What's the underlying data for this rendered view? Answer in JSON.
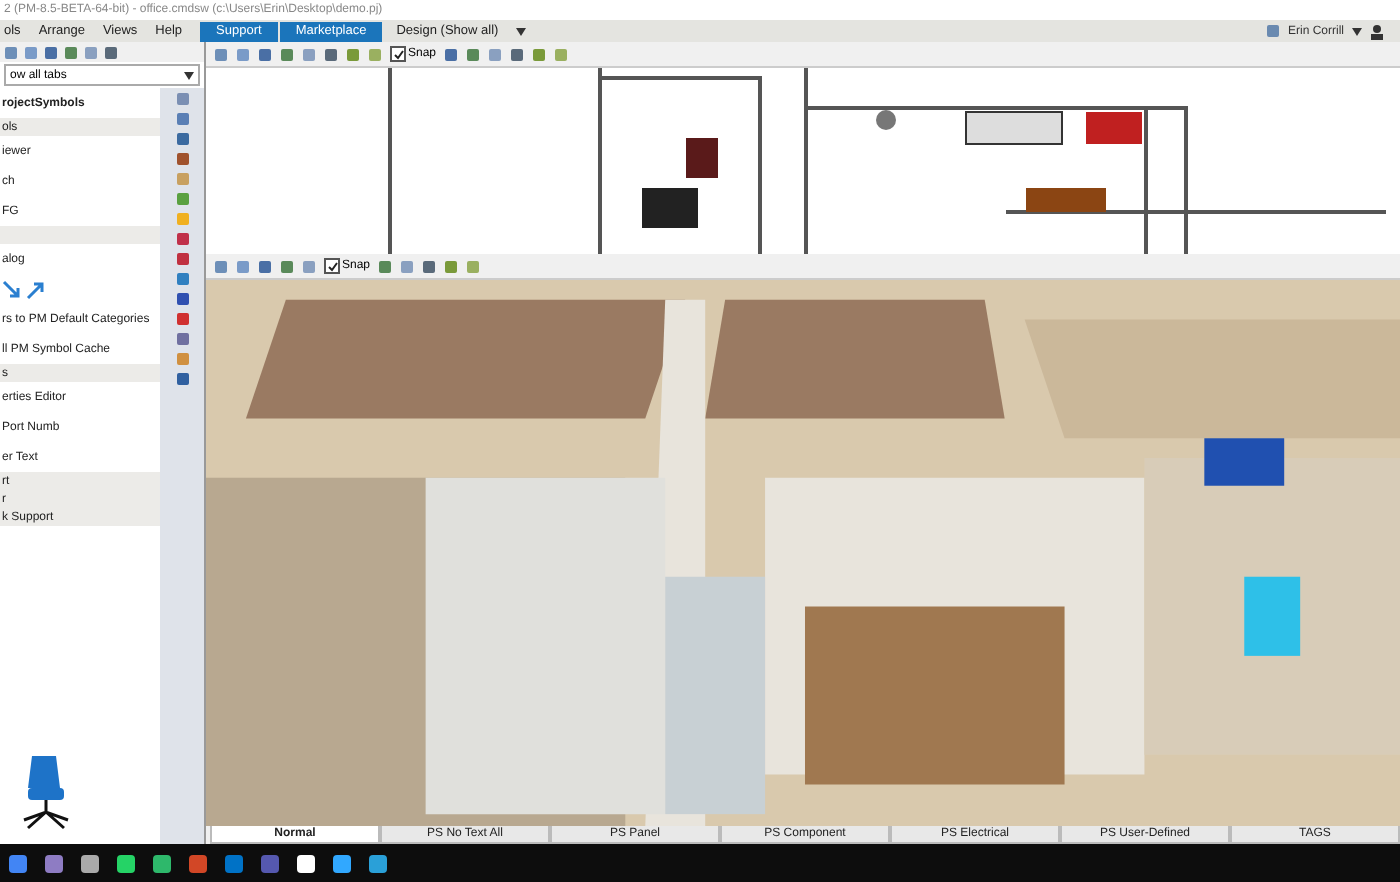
{
  "window": {
    "title": "2 (PM-8.5-BETA-64-bit) - office.cmdsw (c:\\Users\\Erin\\Desktop\\demo.pj)"
  },
  "menu": [
    "ols",
    "Arrange",
    "Views",
    "Help"
  ],
  "menu_buttons": [
    {
      "label": "Support"
    },
    {
      "label": "Marketplace"
    }
  ],
  "view_selector": {
    "label": "Design (Show all)"
  },
  "user": {
    "name": "Erin Corrill"
  },
  "left_panel": {
    "filter": {
      "value": "ow all tabs"
    },
    "items": [
      {
        "kind": "header",
        "label": "rojectSymbols"
      },
      {
        "kind": "section",
        "label": "ols"
      },
      {
        "kind": "item",
        "label": "iewer"
      },
      {
        "kind": "item",
        "label": "ch"
      },
      {
        "kind": "item",
        "label": "FG"
      },
      {
        "kind": "section"
      },
      {
        "kind": "item",
        "label": "alog"
      },
      {
        "kind": "icons"
      },
      {
        "kind": "item",
        "label": "rs to PM Default Categories"
      },
      {
        "kind": "item",
        "label": "ll PM Symbol Cache"
      },
      {
        "kind": "section",
        "label": "s"
      },
      {
        "kind": "item",
        "label": "erties Editor"
      },
      {
        "kind": "item",
        "label": "Port Numb"
      },
      {
        "kind": "item",
        "label": "er Text"
      },
      {
        "kind": "section",
        "label": "rt"
      },
      {
        "kind": "section",
        "label": "r"
      },
      {
        "kind": "section",
        "label": "k Support"
      }
    ]
  },
  "plan_toolbar": {
    "snap": {
      "label": "Snap",
      "checked": true
    }
  },
  "view3d_toolbar": {
    "snap": {
      "label": "Snap",
      "checked": true
    }
  },
  "bottom_tabs": [
    {
      "label": "Normal",
      "selected": true
    },
    {
      "label": "PS No Text All",
      "selected": false
    },
    {
      "label": "PS Panel",
      "selected": false
    },
    {
      "label": "PS Component",
      "selected": false
    },
    {
      "label": "PS Electrical",
      "selected": false
    },
    {
      "label": "PS User-Defined",
      "selected": false
    },
    {
      "label": "TAGS",
      "selected": false
    }
  ]
}
